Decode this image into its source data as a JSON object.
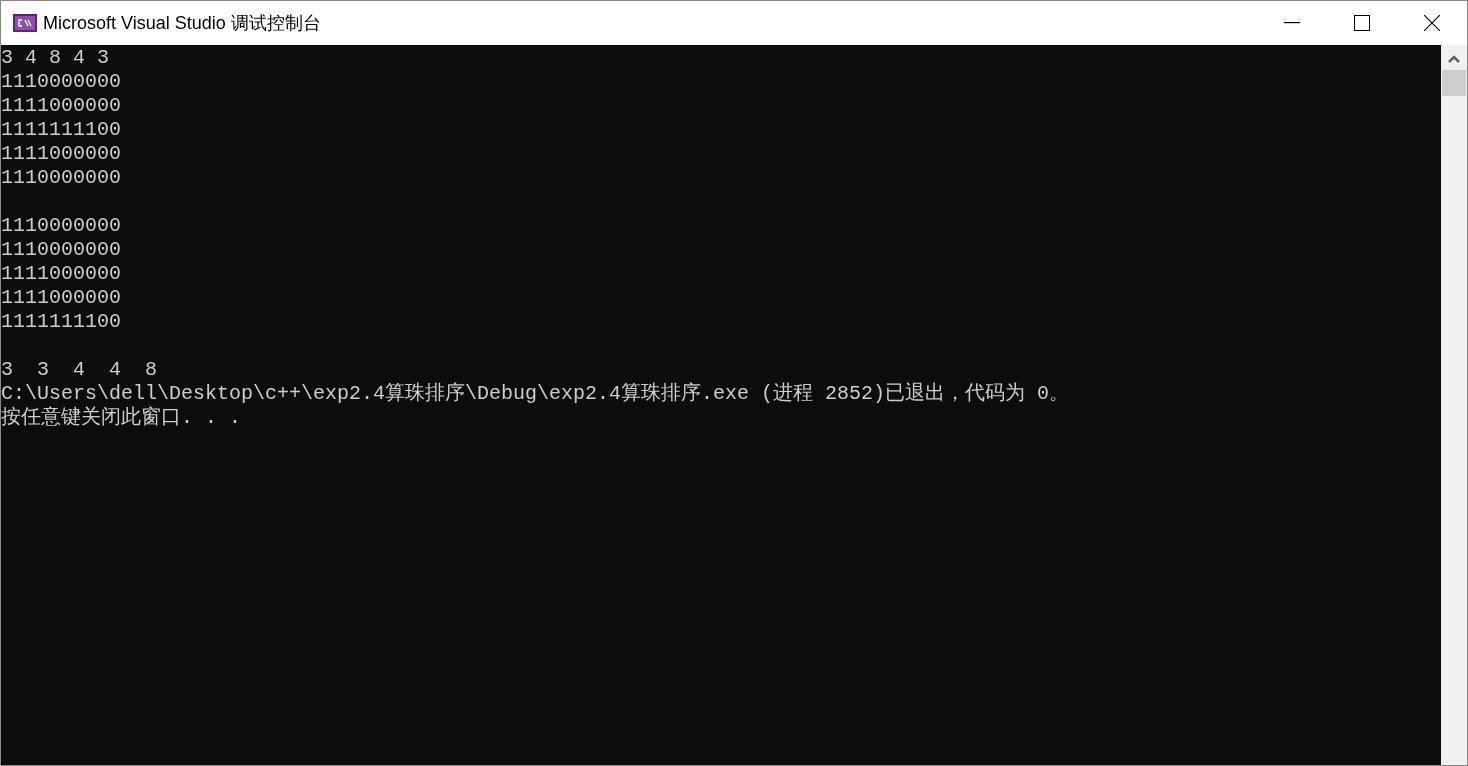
{
  "window": {
    "title": "Microsoft Visual Studio 调试控制台"
  },
  "console": {
    "blocks": [
      [
        "3 4 8 4 3",
        "1110000000",
        "1111000000",
        "1111111100",
        "1111000000",
        "1110000000"
      ],
      [
        "1110000000",
        "1110000000",
        "1111000000",
        "1111000000",
        "1111111100"
      ],
      [
        "3  3  4  4  8",
        "C:\\Users\\dell\\Desktop\\c++\\exp2.4算珠排序\\Debug\\exp2.4算珠排序.exe (进程 2852)已退出，代码为 0。",
        "按任意键关闭此窗口. . ."
      ]
    ]
  }
}
